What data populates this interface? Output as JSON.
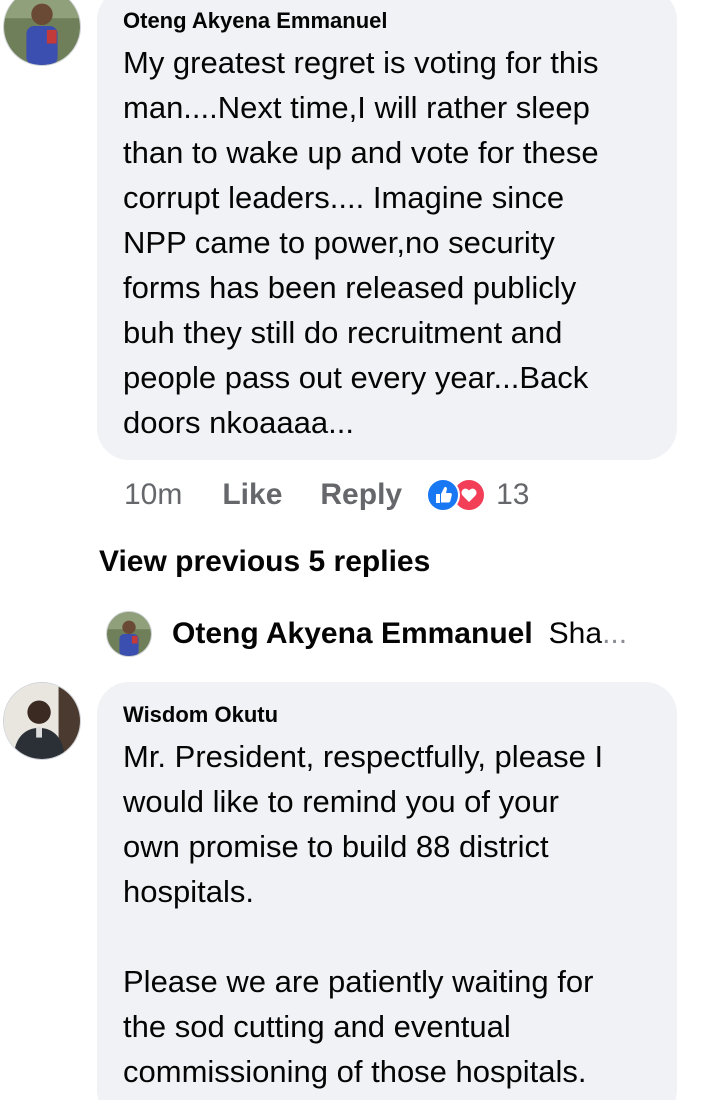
{
  "comments": [
    {
      "author": "Oteng Akyena Emmanuel",
      "text": "My greatest regret is voting for this\nman....Next time,I will rather sleep\nthan to wake up and vote for these\ncorrupt leaders.... Imagine since\nNPP came to power,no security\nforms has been released publicly\nbuh they still do recruitment and\npeople pass out every year...Back\ndoors nkoaaaa...",
      "time": "10m",
      "like_label": "Like",
      "reply_label": "Reply",
      "reaction_count": "13",
      "reaction_icons": [
        "like-icon",
        "love-icon"
      ],
      "colors": {
        "like": "#1877f2",
        "love": "#f33e58"
      }
    },
    {
      "author": "Wisdom Okutu",
      "text": "Mr. President, respectfully, please I\nwould like to remind you of your\nown promise to build 88 district\nhospitals.\n\nPlease we are patiently waiting for\nthe sod cutting and eventual\ncommissioning of those hospitals."
    }
  ],
  "view_previous": "View previous 5 replies",
  "reply_preview": {
    "author": "Oteng Akyena Emmanuel",
    "snippet": "Sha",
    "ellipsis": "..."
  },
  "colors": {
    "bubble": "#f0f2f5",
    "secondary_text": "#65676b",
    "primary_text": "#050505"
  }
}
